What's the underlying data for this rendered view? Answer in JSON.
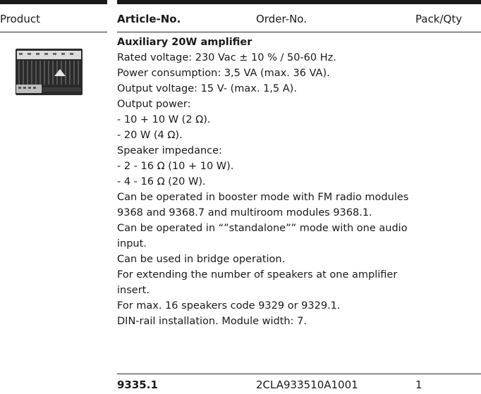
{
  "table": {
    "headers": {
      "product": "Product",
      "article_no": "Article-No.",
      "order_no": "Order-No.",
      "pack_qty": "Pack/Qty"
    }
  },
  "product": {
    "image_icon": "amplifier-module-image",
    "title": "Auxiliary 20W amplifier",
    "description_lines": [
      "Rated voltage: 230 Vac ± 10 % / 50-60 Hz.",
      "Power consumption: 3,5 VA (max. 36 VA).",
      "Output voltage: 15 V- (max. 1,5 A).",
      "Output power:",
      "- 10 + 10 W (2 Ω).",
      "- 20 W (4 Ω).",
      "Speaker impedance:",
      "- 2 - 16 Ω (10 + 10 W).",
      "- 4 - 16 Ω (20 W).",
      "Can be operated in booster mode with FM radio modules",
      "9368 and 9368.7 and multiroom modules 9368.1.",
      "Can be operated in “”standalone”” mode with one audio",
      "input.",
      "Can be used in bridge operation.",
      "For extending the number of speakers at one amplifier",
      "insert.",
      "For max. 16 speakers code 9329 or 9329.1.",
      "DIN-rail installation. Module width: 7."
    ],
    "article_no": "9335.1",
    "order_no": "2CLA933510A1001",
    "pack_qty": "1"
  }
}
